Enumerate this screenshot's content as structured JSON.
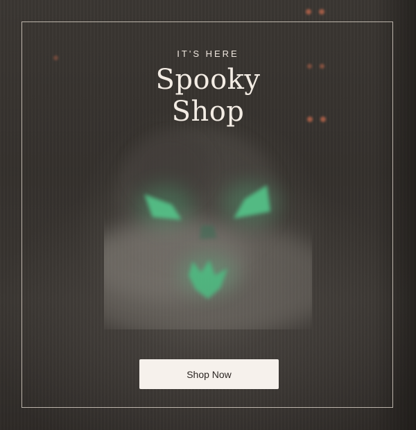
{
  "hero": {
    "eyebrow": "IT'S HERE",
    "title_line1": "Spooky",
    "title_line2": "Shop",
    "cta_label": "Shop Now",
    "image_subject": "glowing jack-o-lantern in fog",
    "colors": {
      "background": "#35312d",
      "text": "#f3ece4",
      "button_bg": "#f6f1ec",
      "button_text": "#2b2522",
      "glow": "#4fd08a",
      "string_lights": "#c46a4e"
    }
  }
}
